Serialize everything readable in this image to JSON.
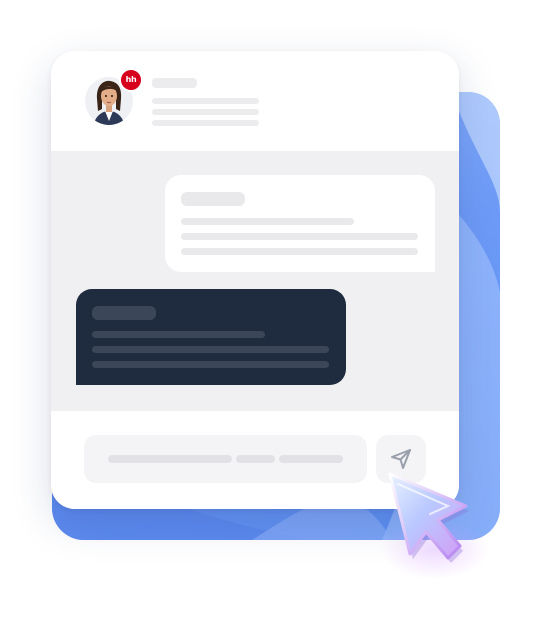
{
  "header": {
    "avatar_badge": "hh",
    "badge_color": "#d6001c"
  },
  "colors": {
    "outgoing_bubble": "#1f2b3f",
    "incoming_bubble": "#ffffff",
    "chat_background": "#f0f0f2",
    "backdrop_accent": "#6e9bf7"
  },
  "icons": {
    "send": "send-icon",
    "cursor": "pointer-cursor-icon",
    "avatar": "avatar-icon"
  }
}
